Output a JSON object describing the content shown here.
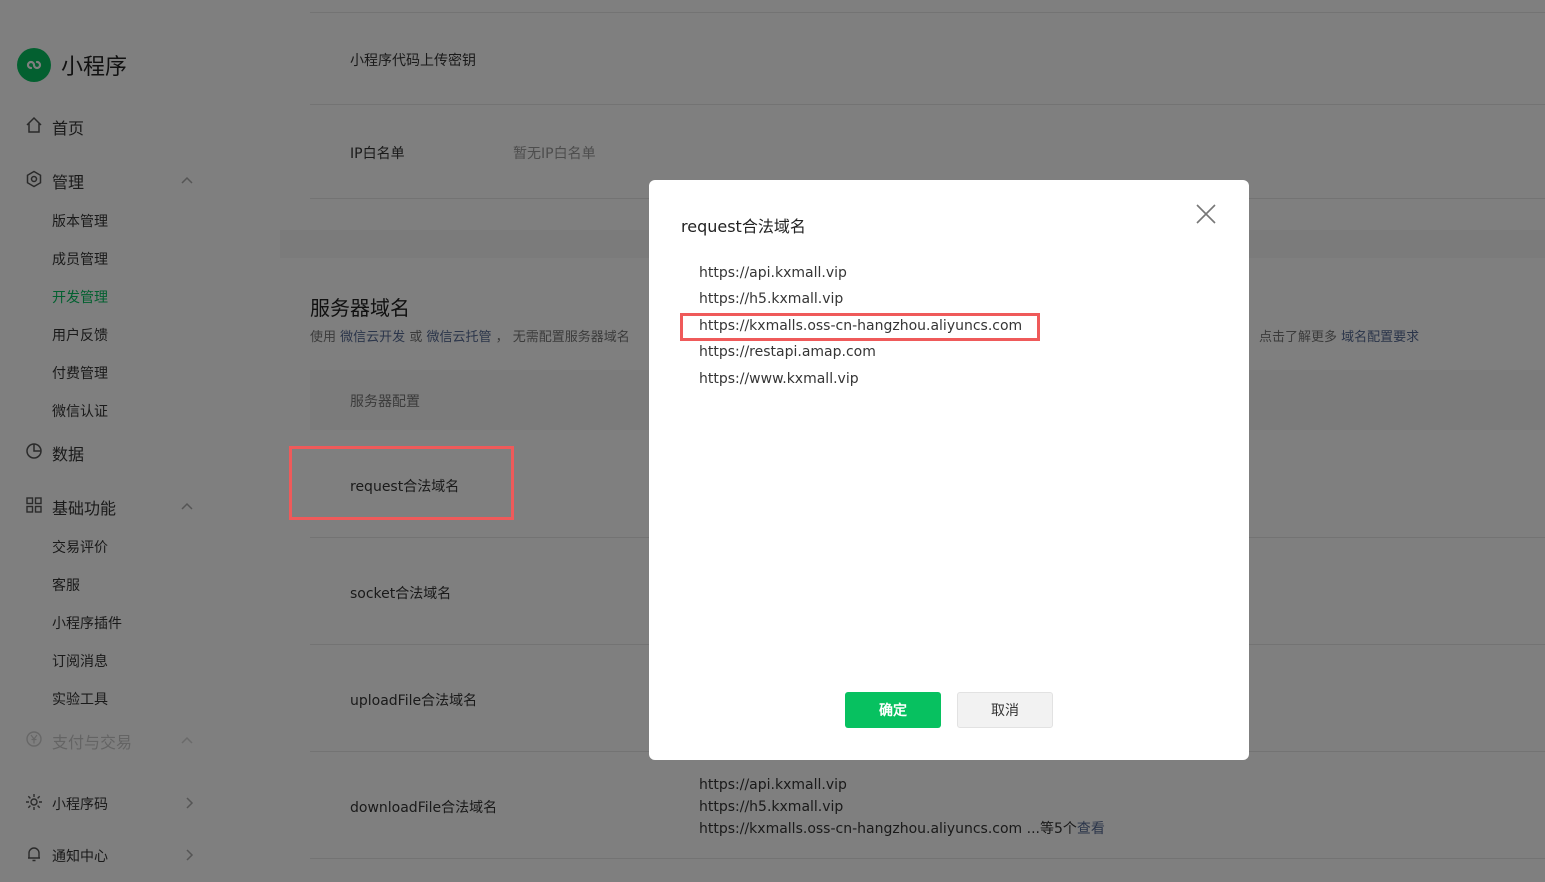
{
  "sidebar": {
    "logo_text": "小程序",
    "home": "首页",
    "manage": {
      "label": "管理",
      "items": [
        "版本管理",
        "成员管理",
        "开发管理",
        "用户反馈",
        "付费管理",
        "微信认证"
      ]
    },
    "data": "数据",
    "basic": {
      "label": "基础功能",
      "items": [
        "交易评价",
        "客服",
        "小程序插件",
        "订阅消息",
        "实验工具"
      ]
    },
    "pay": "支付与交易",
    "qrcode": "小程序码",
    "notice": "通知中心"
  },
  "main": {
    "upload_key_label": "小程序代码上传密钥",
    "ip_whitelist_label": "IP白名单",
    "ip_whitelist_value": "暂无IP白名单",
    "server_domain_title": "服务器域名",
    "desc_prefix": "使用",
    "desc_link1": "微信云开发",
    "desc_or": "或",
    "desc_link2": "微信云托管",
    "desc_suffix": "， 无需配置服务器域名",
    "desc_right": "点击了解更多",
    "desc_right_link": "域名配置要求",
    "table_head": "服务器配置",
    "rows": {
      "request": "request合法域名",
      "socket": "socket合法域名",
      "upload": "uploadFile合法域名",
      "download": "downloadFile合法域名"
    },
    "download_values": [
      "https://api.kxmall.vip",
      "https://h5.kxmall.vip",
      "https://kxmalls.oss-cn-hangzhou.aliyuncs.com"
    ],
    "download_more": "...等5个",
    "download_view": "查看"
  },
  "dialog": {
    "title": "request合法域名",
    "domains": [
      "https://api.kxmall.vip",
      "https://h5.kxmall.vip",
      "https://kxmalls.oss-cn-hangzhou.aliyuncs.com",
      "https://restapi.amap.com",
      "https://www.kxmall.vip"
    ],
    "ok": "确定",
    "cancel": "取消"
  },
  "colors": {
    "brand": "#07c160",
    "highlight": "#ef5a5a",
    "link": "#576b95"
  },
  "icons": {
    "logo": "miniprogram-logo-icon",
    "home": "home-icon",
    "manage": "gear-icon",
    "data": "pie-chart-icon",
    "basic": "grid-icon",
    "pay": "yen-icon",
    "qrcode": "qrcode-icon",
    "notice": "bell-icon",
    "close": "close-icon"
  }
}
